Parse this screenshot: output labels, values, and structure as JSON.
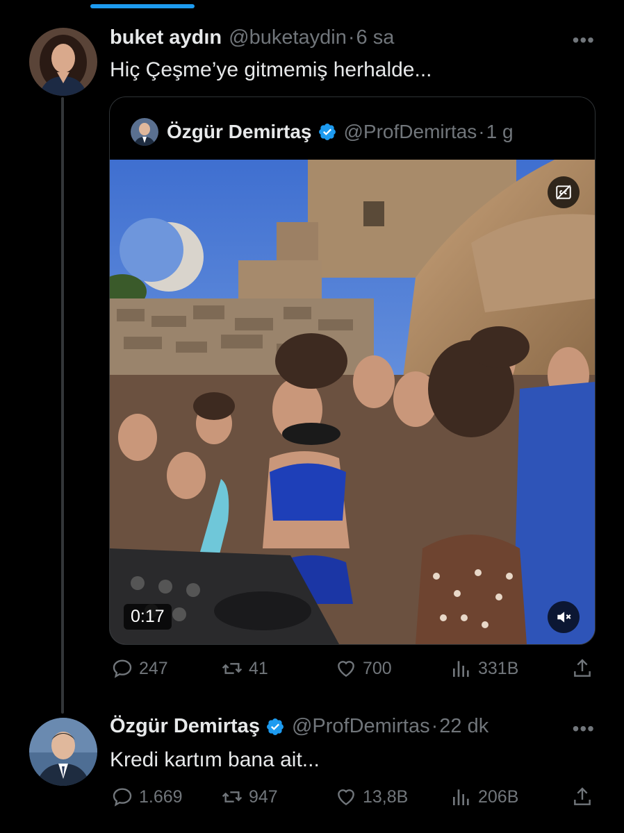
{
  "tweet1": {
    "name": "buket aydın",
    "handle": "@buketaydin",
    "dot": "·",
    "time": "6 sa",
    "more": "•••",
    "text": "Hiç Çeşme’ye gitmemiş herhalde..."
  },
  "quote": {
    "name": "Özgür Demirtaş",
    "handle": "@ProfDemirtas",
    "dot": "·",
    "time": "1 g",
    "video_duration": "0:17"
  },
  "tweet1_actions": {
    "replies": "247",
    "retweets": "41",
    "likes": "700",
    "views": "331B"
  },
  "tweet2": {
    "name": "Özgür Demirtaş",
    "handle": "@ProfDemirtas",
    "dot": "·",
    "time": "22 dk",
    "more": "•••",
    "text": "Kredi kartım bana ait..."
  },
  "tweet2_actions": {
    "replies": "1.669",
    "retweets": "947",
    "likes": "13,8B",
    "views": "206B"
  },
  "colors": {
    "background": "#000000",
    "verified": "#1d9bf0",
    "secondary_text": "#71767b"
  }
}
